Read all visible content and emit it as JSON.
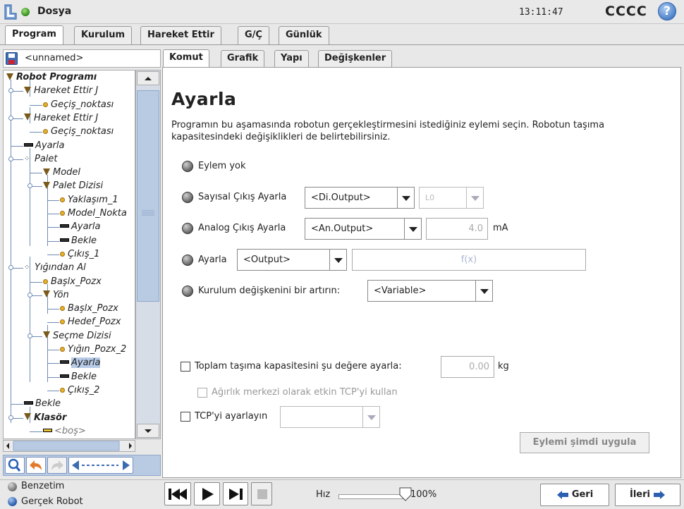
{
  "header": {
    "title": "Dosya",
    "clock": "13:11:47",
    "robot_name": "CCCC",
    "help": "?"
  },
  "main_tabs": [
    "Program",
    "Kurulum",
    "Hareket Ettir",
    "G/Ç",
    "Günlük"
  ],
  "file": {
    "name": "<unnamed>"
  },
  "tree": [
    {
      "label": "Robot Programı",
      "icon": "none",
      "bold": true
    },
    {
      "label": "Hareket Ettir J",
      "icon": "triangle"
    },
    {
      "label": "Geçiş_noktası",
      "icon": "waypoint"
    },
    {
      "label": "Hareket Ettir J",
      "icon": "triangle"
    },
    {
      "label": "Geçiş_noktası",
      "icon": "waypoint"
    },
    {
      "label": "Ayarla",
      "icon": "set"
    },
    {
      "label": "Palet",
      "icon": "pallet"
    },
    {
      "label": "Model",
      "icon": "triangle"
    },
    {
      "label": "Palet Dizisi",
      "icon": "triangle"
    },
    {
      "label": "Yaklaşım_1",
      "icon": "waypoint"
    },
    {
      "label": "Model_Nokta",
      "icon": "waypoint"
    },
    {
      "label": "Ayarla",
      "icon": "set"
    },
    {
      "label": "Bekle",
      "icon": "set"
    },
    {
      "label": "Çıkış_1",
      "icon": "waypoint"
    },
    {
      "label": "Yığından Al",
      "icon": "pallet"
    },
    {
      "label": "Başlx_Pozx",
      "icon": "waypoint"
    },
    {
      "label": "Yön",
      "icon": "triangle"
    },
    {
      "label": "Başlx_Pozx",
      "icon": "waypoint"
    },
    {
      "label": "Hedef_Pozx",
      "icon": "waypoint"
    },
    {
      "label": "Seçme Dizisi",
      "icon": "triangle"
    },
    {
      "label": "Yığın_Pozx_2",
      "icon": "waypoint"
    },
    {
      "label": "Ayarla",
      "icon": "set",
      "selected": true
    },
    {
      "label": "Bekle",
      "icon": "set"
    },
    {
      "label": "Çıkış_2",
      "icon": "waypoint"
    },
    {
      "label": "Bekle",
      "icon": "set"
    },
    {
      "label": "Klasör",
      "icon": "triangle",
      "bold": true
    },
    {
      "label": "<boş>",
      "icon": "empty"
    }
  ],
  "content_tabs": [
    "Komut",
    "Grafik",
    "Yapı",
    "Değişkenler"
  ],
  "page": {
    "title": "Ayarla",
    "description": "Programın bu aşamasında robotun gerçekleştirmesini istediğiniz eylemi seçin. Robotun taşıma kapasitesindeki değişiklikleri de belirtebilirsiniz."
  },
  "options": {
    "no_action": "Eylem yok",
    "digital_label": "Sayısal Çıkış Ayarla",
    "digital_select": "<Di.Output>",
    "digital_value": "L0",
    "analog_label": "Analog Çıkış Ayarla",
    "analog_select": "<An.Output>",
    "analog_value": "4.0",
    "analog_unit": "mA",
    "set_label": "Ayarla",
    "set_select": "<Output>",
    "set_expr": "f(x)",
    "inc_label": "Kurulum değişkenini bir artırın:",
    "inc_select": "<Variable>"
  },
  "payload": {
    "label": "Toplam taşıma kapasitesini şu değere ayarla:",
    "value": "0.00",
    "unit": "kg",
    "cog_label": "Ağırlık merkezi olarak etkin TCP'yi kullan",
    "tcp_label": "TCP'yi ayarlayın"
  },
  "apply_button": "Eylemi şimdi uygula",
  "footer": {
    "sim_label": "Benzetim",
    "real_label": "Gerçek Robot",
    "speed_label": "Hız",
    "speed_value": "100%",
    "speed_fraction": 1.0,
    "back_label": "Geri",
    "next_label": "İleri"
  }
}
